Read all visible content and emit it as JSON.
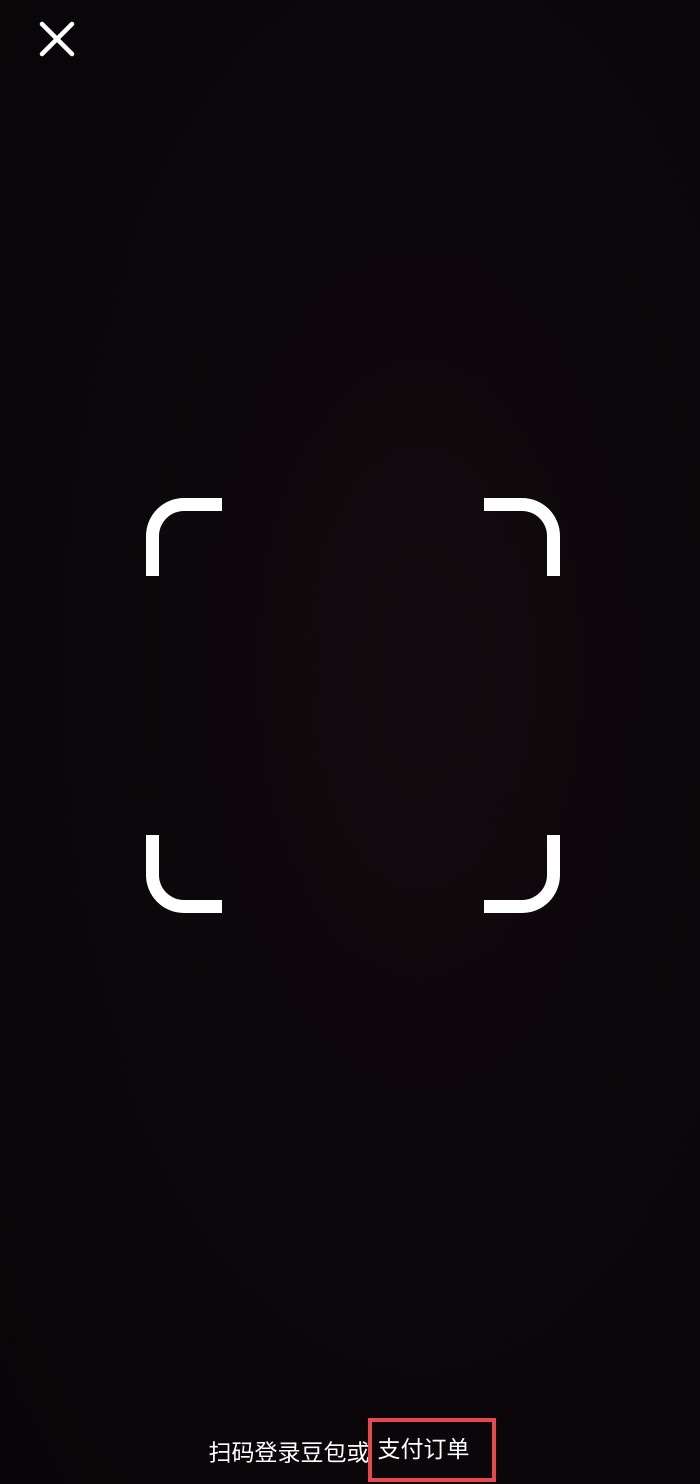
{
  "header": {
    "close_icon": "close-icon"
  },
  "scanner": {
    "frame_icon": "scan-frame-corners"
  },
  "hint": {
    "text": "扫码登录豆包或",
    "link_text": "支付订单",
    "highlight_color": "#e8474d"
  }
}
